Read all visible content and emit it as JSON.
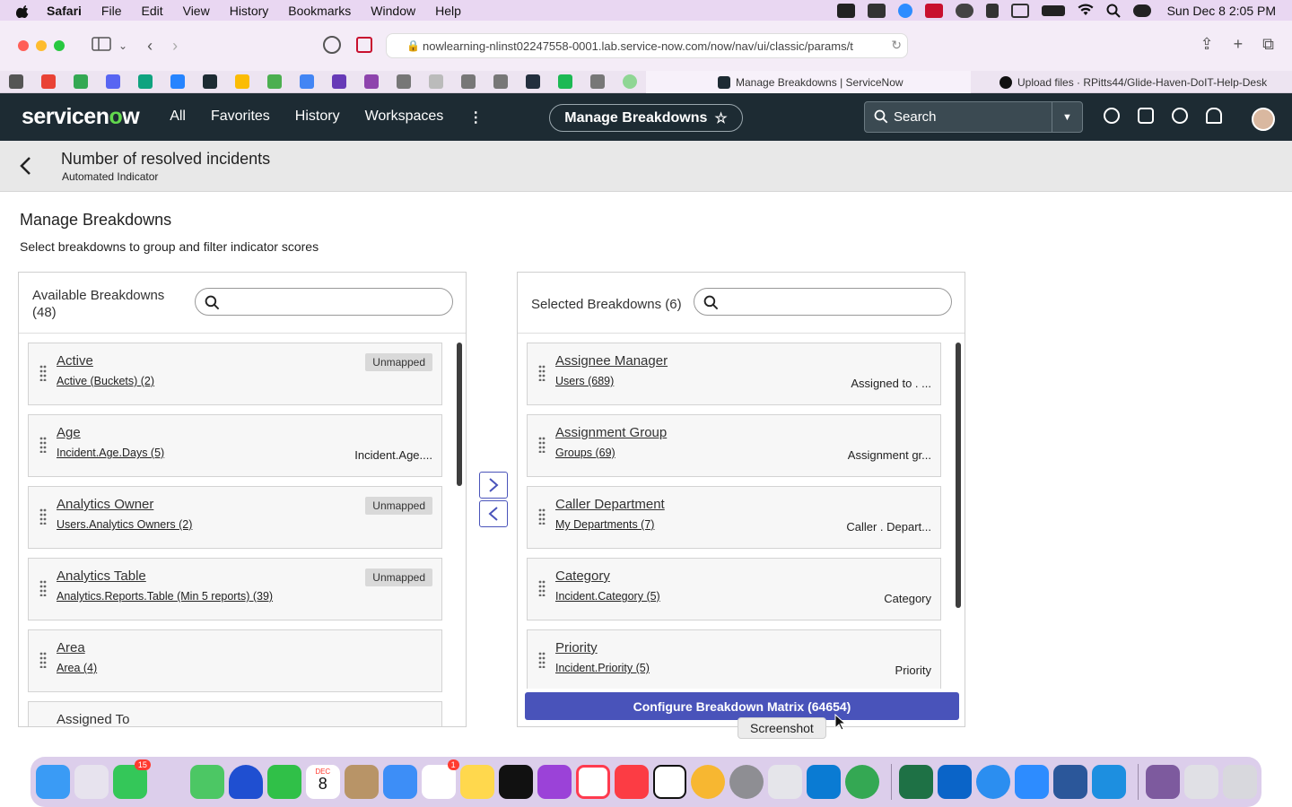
{
  "menubar": {
    "app": "Safari",
    "items": [
      "File",
      "Edit",
      "View",
      "History",
      "Bookmarks",
      "Window",
      "Help"
    ],
    "datetime": "Sun Dec 8  2:05 PM"
  },
  "browser": {
    "url": "nowlearning-nlinst02247558-0001.lab.service-now.com/now/nav/ui/classic/params/t",
    "tabs": [
      {
        "title": "Manage Breakdowns | ServiceNow",
        "active": true
      },
      {
        "title": "Upload files · RPitts44/Glide-Haven-DoIT-Help-Desk",
        "active": false
      }
    ]
  },
  "sn": {
    "logo": "servicenow",
    "nav": [
      "All",
      "Favorites",
      "History",
      "Workspaces"
    ],
    "more": "⋮",
    "context_pill": "Manage Breakdowns",
    "search_label": "Search"
  },
  "subheader": {
    "title": "Number of resolved incidents",
    "subtitle": "Automated Indicator"
  },
  "page": {
    "title": "Manage Breakdowns",
    "description": "Select breakdowns to group and filter indicator scores"
  },
  "available": {
    "label": "Available Breakdowns (48)",
    "search_placeholder": "",
    "items": [
      {
        "name": "Active",
        "source": "Active (Buckets) (2)",
        "badge": "Unmapped",
        "mapping": ""
      },
      {
        "name": "Age",
        "source": "Incident.Age.Days (5)",
        "badge": "",
        "mapping": "Incident.Age...."
      },
      {
        "name": "Analytics Owner",
        "source": "Users.Analytics Owners (2)",
        "badge": "Unmapped",
        "mapping": ""
      },
      {
        "name": "Analytics Table",
        "source": "Analytics.Reports.Table (Min 5 reports) (39)",
        "badge": "Unmapped",
        "mapping": ""
      },
      {
        "name": "Area",
        "source": "Area (4)",
        "badge": "",
        "mapping": ""
      },
      {
        "name": "Assigned To",
        "source": "",
        "badge": "",
        "mapping": ""
      }
    ]
  },
  "selected": {
    "label": "Selected Breakdowns (6)",
    "search_placeholder": "",
    "items": [
      {
        "name": "Assignee Manager",
        "source": "Users (689)",
        "mapping": "Assigned to . ..."
      },
      {
        "name": "Assignment Group",
        "source": "Groups (69)",
        "mapping": "Assignment gr..."
      },
      {
        "name": "Caller Department",
        "source": "My Departments (7)",
        "mapping": "Caller . Depart..."
      },
      {
        "name": "Category",
        "source": "Incident.Category (5)",
        "mapping": "Category"
      },
      {
        "name": "Priority",
        "source": "Incident.Priority (5)",
        "mapping": "Priority"
      }
    ],
    "configure_button": "Configure Breakdown Matrix (64654)"
  },
  "tooltip": "Screenshot",
  "dock_badges": {
    "messages": "15",
    "reminders": "1",
    "calendar_month": "DEC",
    "calendar_day": "8"
  },
  "colors": {
    "header": "#1d2b33",
    "accent": "#4953ba",
    "menubar": "#e9d7f2",
    "logo_green": "#62d84e"
  }
}
